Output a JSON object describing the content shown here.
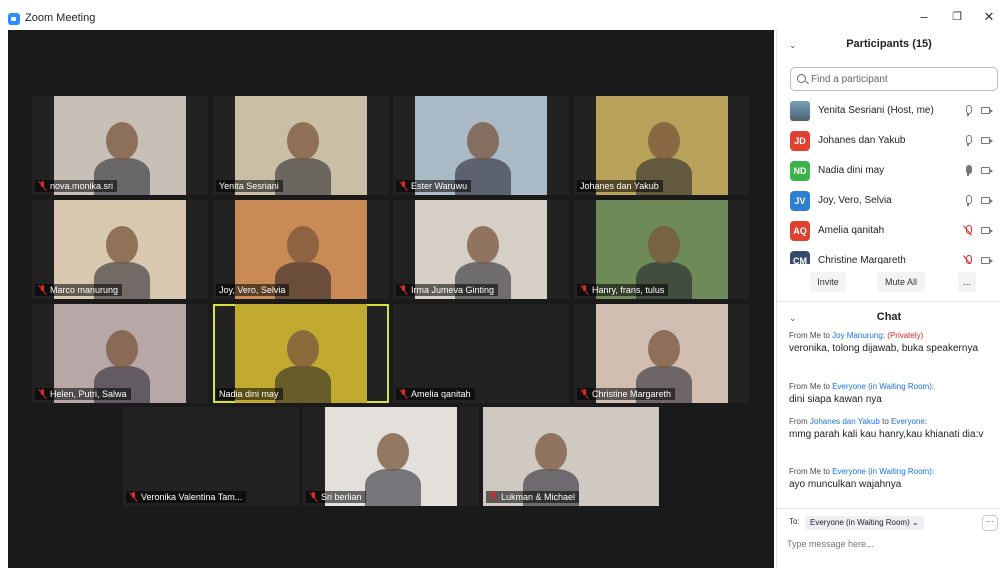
{
  "window": {
    "title": "Zoom Meeting",
    "minimize_icon": "minimize-icon",
    "restore_icon": "restore-icon",
    "close_icon": "close-icon"
  },
  "video_tiles": [
    {
      "name": "nova.monika.sri",
      "muted": true,
      "bg": "#c8c0b6"
    },
    {
      "name": "Yenita Sesriani",
      "muted": false,
      "bg": "#c9bfa4"
    },
    {
      "name": "Ester Waruwu",
      "muted": true,
      "bg": "#a9b9c6"
    },
    {
      "name": "Johanes dan Yakub",
      "muted": false,
      "bg": "#b9a35a"
    },
    {
      "name": "Marco manurung",
      "muted": true,
      "bg": "#d8c8b0"
    },
    {
      "name": "Joy, Vero, Selvia",
      "muted": false,
      "bg": "#c98a55"
    },
    {
      "name": "Irma Jumeva Ginting",
      "muted": true,
      "bg": "#d6cfc6"
    },
    {
      "name": "Hanry, frans, tulus",
      "muted": true,
      "bg": "#6e8a58"
    },
    {
      "name": "Helen, Putri, Salwa",
      "muted": true,
      "bg": "#b7a7a7"
    },
    {
      "name": "Nadia dini may",
      "muted": false,
      "bg": "#c2aa30"
    },
    {
      "name": "Amelia qanitah",
      "muted": true,
      "bg": "#222222"
    },
    {
      "name": "Christine Margareth",
      "muted": true,
      "bg": "#d1bdb1"
    },
    {
      "name": "Veronika Valentina Tam...",
      "muted": true,
      "bg": "#222222"
    },
    {
      "name": "Sri berlian",
      "muted": true,
      "bg": "#e3e0db"
    },
    {
      "name": "Lukman & Michael",
      "muted": true,
      "bg": "#cfc9c2"
    }
  ],
  "participants": {
    "title": "Participants (15)",
    "search_placeholder": "Find a participant",
    "list": [
      {
        "initials": "",
        "color": "#5a7a8a",
        "name": "Yenita Sesriani (Host, me)",
        "mic": "on"
      },
      {
        "initials": "JD",
        "color": "#e0402e",
        "name": "Johanes dan Yakub",
        "mic": "on"
      },
      {
        "initials": "ND",
        "color": "#3bb34a",
        "name": "Nadia dini may",
        "mic": "active"
      },
      {
        "initials": "JV",
        "color": "#2d7fd3",
        "name": "Joy, Vero, Selvia",
        "mic": "on"
      },
      {
        "initials": "AQ",
        "color": "#e0402e",
        "name": "Amelia qanitah",
        "mic": "muted"
      },
      {
        "initials": "CM",
        "color": "#3a4a6a",
        "name": "Christine Margareth",
        "mic": "muted"
      }
    ],
    "invite_label": "Invite",
    "mute_all_label": "Mute All",
    "more_label": "..."
  },
  "chat": {
    "title": "Chat",
    "messages": [
      {
        "from": "From Me to ",
        "to": "Joy Manurung",
        "suffix": ":",
        "private": " (Privately)",
        "text": "veronika, tolong dijawab, buka speakernya"
      },
      {
        "from": "From Me to ",
        "to": "Everyone (in Waiting Room)",
        "suffix": ":",
        "private": "",
        "text": "dini siapa kawan nya"
      },
      {
        "from": "From ",
        "sender": "Johanes dan Yakub",
        "mid": " to ",
        "to": "Everyone",
        "suffix": ":",
        "private": "",
        "text": "mmg parah kali kau hanry,kau khianati dia:v"
      },
      {
        "from": "From Me to ",
        "to": "Everyone (in Waiting Room)",
        "suffix": ":",
        "private": "",
        "text": "ayo munculkan wajahnya"
      }
    ],
    "to_label": "To:",
    "to_value": "Everyone (in Waiting Room) ⌄",
    "more_label": "···",
    "input_placeholder": "Type message here..."
  }
}
